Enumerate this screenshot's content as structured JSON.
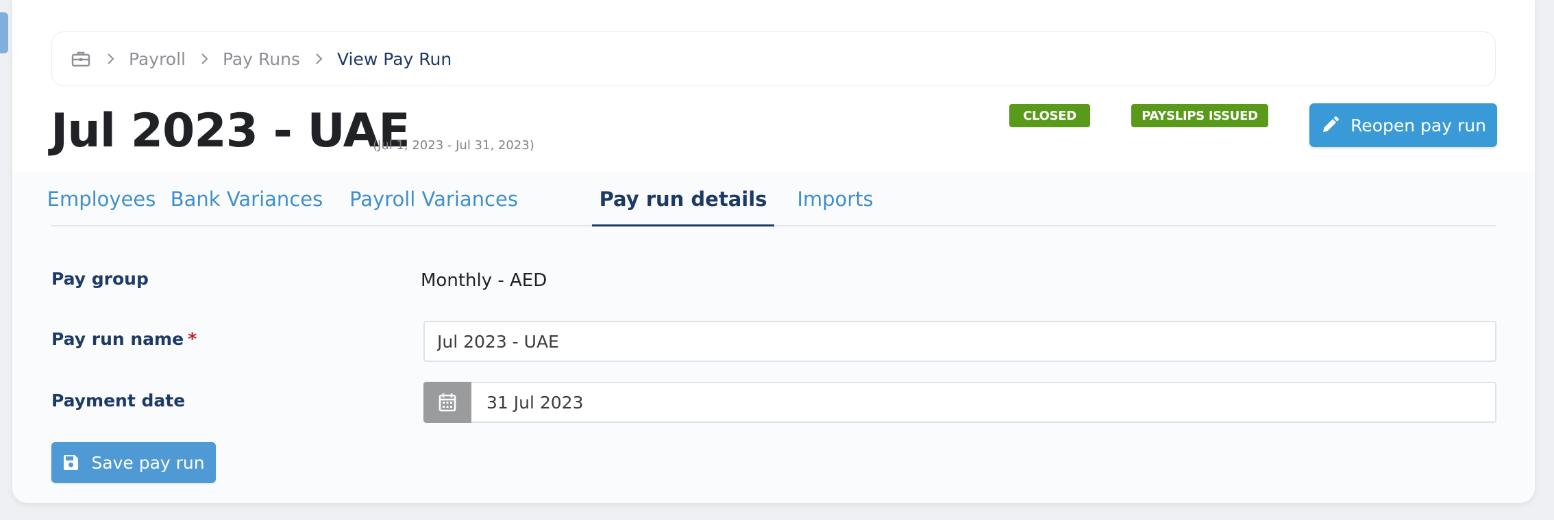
{
  "breadcrumb": {
    "home_icon": "briefcase-icon",
    "items": [
      {
        "label": "Payroll"
      },
      {
        "label": "Pay Runs"
      },
      {
        "label": "View Pay Run"
      }
    ]
  },
  "header": {
    "title": "Jul 2023 - UAE",
    "subtitle": "(Jul 1, 2023 - Jul 31, 2023)",
    "badges": [
      {
        "label": "CLOSED",
        "color": "#5a9a1a"
      },
      {
        "label": "PAYSLIPS ISSUED",
        "color": "#5a9a1a"
      }
    ],
    "reopen_button": {
      "label": "Reopen pay run",
      "icon": "pencil-icon"
    }
  },
  "tabs": [
    {
      "label": "Employees",
      "active": false
    },
    {
      "label": "Bank Variances",
      "active": false
    },
    {
      "label": "Payroll Variances",
      "active": false
    },
    {
      "label": "Pay run details",
      "active": true
    },
    {
      "label": "Imports",
      "active": false
    }
  ],
  "form": {
    "pay_group": {
      "label": "Pay group",
      "value": "Monthly - AED"
    },
    "pay_run_name": {
      "label": "Pay run name",
      "required_mark": "*",
      "value": "Jul 2023 - UAE"
    },
    "payment_date": {
      "label": "Payment date",
      "value": "31 Jul 2023",
      "icon": "calendar-icon"
    }
  },
  "save_button": {
    "label": "Save pay run",
    "icon": "floppy-disk-icon"
  },
  "colors": {
    "primary": "#3a9ad7",
    "navy": "#1d3a66",
    "success": "#5a9a1a",
    "required": "#c0202b"
  }
}
